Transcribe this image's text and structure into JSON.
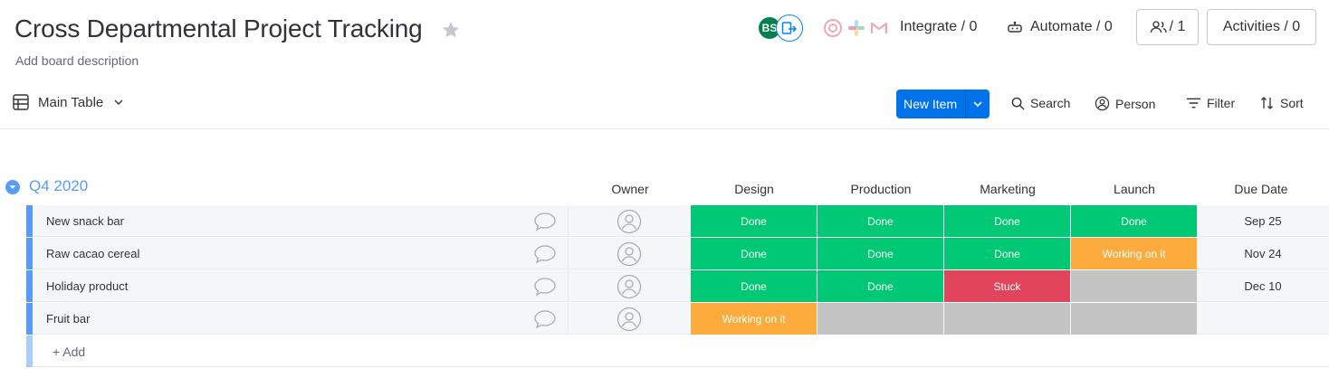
{
  "board": {
    "title": "Cross Departmental Project Tracking",
    "description": "Add board description"
  },
  "header": {
    "avatar_initials": "BS",
    "integrate_label": "Integrate / 0",
    "automate_label": "Automate / 0",
    "members_label": "/ 1",
    "activities_label": "Activities / 0"
  },
  "toolbar": {
    "view_label": "Main Table",
    "new_item_label": "New Item",
    "search_label": "Search",
    "person_label": "Person",
    "filter_label": "Filter",
    "sort_label": "Sort"
  },
  "group": {
    "title": "Q4 2020",
    "color": "#579bfc",
    "columns": [
      "Owner",
      "Design",
      "Production",
      "Marketing",
      "Launch",
      "Due Date"
    ],
    "add_label": "+ Add"
  },
  "status_colors": {
    "Done": "#00c875",
    "Working on it": "#fdab3d",
    "Stuck": "#e2445c",
    "empty": "#c4c4c4"
  },
  "rows": [
    {
      "name": "New snack bar",
      "design": "Done",
      "production": "Done",
      "marketing": "Done",
      "launch": "Done",
      "due": "Sep 25"
    },
    {
      "name": "Raw cacao cereal",
      "design": "Done",
      "production": "Done",
      "marketing": "Done",
      "launch": "Working on it",
      "due": "Nov 24"
    },
    {
      "name": "Holiday product",
      "design": "Done",
      "production": "Done",
      "marketing": "Stuck",
      "launch": "",
      "due": "Dec 10"
    },
    {
      "name": "Fruit bar",
      "design": "Working on it",
      "production": "",
      "marketing": "",
      "launch": "",
      "due": ""
    }
  ]
}
